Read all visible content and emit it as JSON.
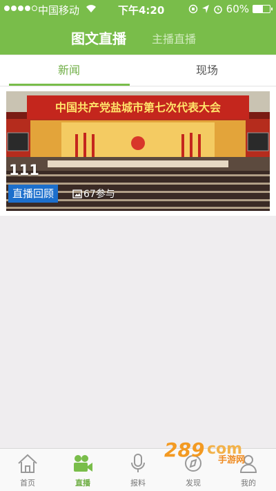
{
  "status_bar": {
    "carrier": "中国移动",
    "time": "下午4:20",
    "battery": "60%",
    "battery_level": 0.6
  },
  "header": {
    "active_title": "图文直播",
    "other_title": "主播直播"
  },
  "tabs": [
    {
      "label": "新闻",
      "active": true
    },
    {
      "label": "现场",
      "active": false
    }
  ],
  "card": {
    "banner_text": "中国共产党盐城市第七次代表大会",
    "title": "111",
    "badge": "直播回顾",
    "participants": "67参与"
  },
  "bottom_nav": [
    {
      "label": "首页",
      "icon": "home-icon"
    },
    {
      "label": "直播",
      "icon": "video-camera-icon",
      "active": true
    },
    {
      "label": "报料",
      "icon": "microphone-icon"
    },
    {
      "label": "发现",
      "icon": "discover-icon"
    },
    {
      "label": "我的",
      "icon": "user-icon"
    }
  ],
  "watermark": {
    "text": "手游网"
  },
  "colors": {
    "brand_green": "#79bd4a",
    "badge_blue": "#1c6fcc"
  }
}
